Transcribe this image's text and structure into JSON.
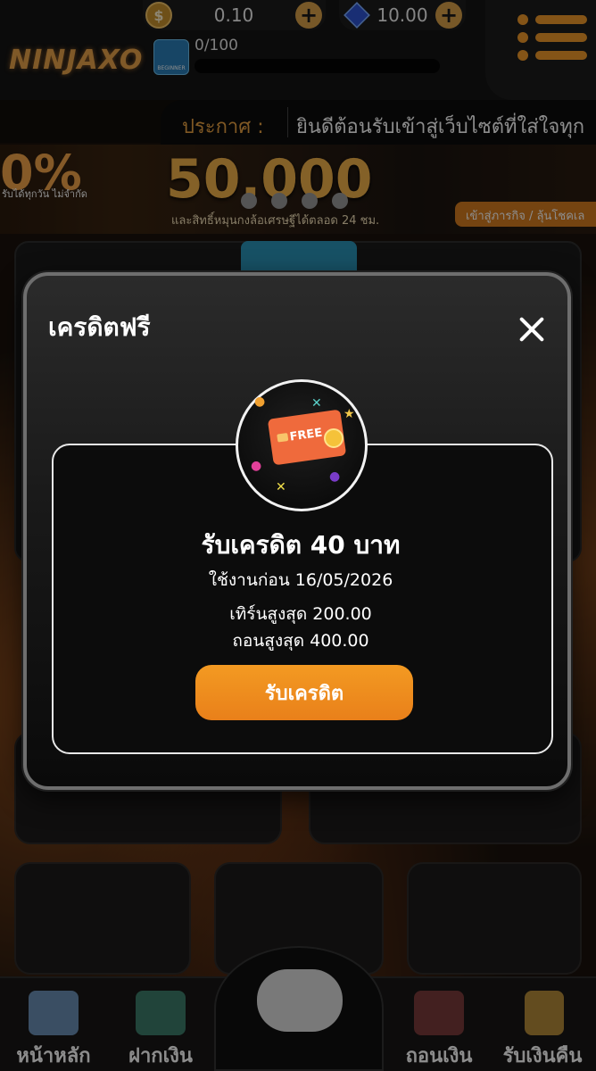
{
  "app": {
    "logo_text": "NINJAXO"
  },
  "header": {
    "coin_balance": "0.10",
    "gem_balance": "10.00",
    "rank_badge_text": "BEGINNER",
    "xp_progress": "0/100",
    "xp_fraction": 0.0
  },
  "announcement": {
    "label": "ประกาศ :",
    "text": "ยินดีต้อนรับเข้าสู่เว็บไซต์ที่ใส่ใจทุก"
  },
  "banner": {
    "left_percent": "0%",
    "left_sub": "รับได้ทุกวัน ไม่จำกัด",
    "amount": "50,000",
    "sub": "และสิทธิ์หมุนกงล้อเศรษฐีได้ตลอด 24 ชม.",
    "cta": "เข้าสู่ภารกิจ / ลุ้นโชคเล"
  },
  "modal": {
    "title": "เครดิตฟรี",
    "badge_text": "FREE",
    "reward_title": "รับเครดิต 40 บาท",
    "use_before": "ใช้งานก่อน 16/05/2026",
    "max_turnover": "เทิร์นสูงสุด 200.00",
    "max_withdraw": "ถอนสูงสุด 400.00",
    "claim_label": "รับเครดิต"
  },
  "bottom_nav": {
    "home": "หน้าหลัก",
    "deposit": "ฝากเงิน",
    "withdraw": "ถอนเงิน",
    "cashback": "รับเงินคืน"
  },
  "colors": {
    "accent_orange": "#f09a2a",
    "claim_button": "#ef8a1e",
    "announce_label": "#e8a042"
  }
}
